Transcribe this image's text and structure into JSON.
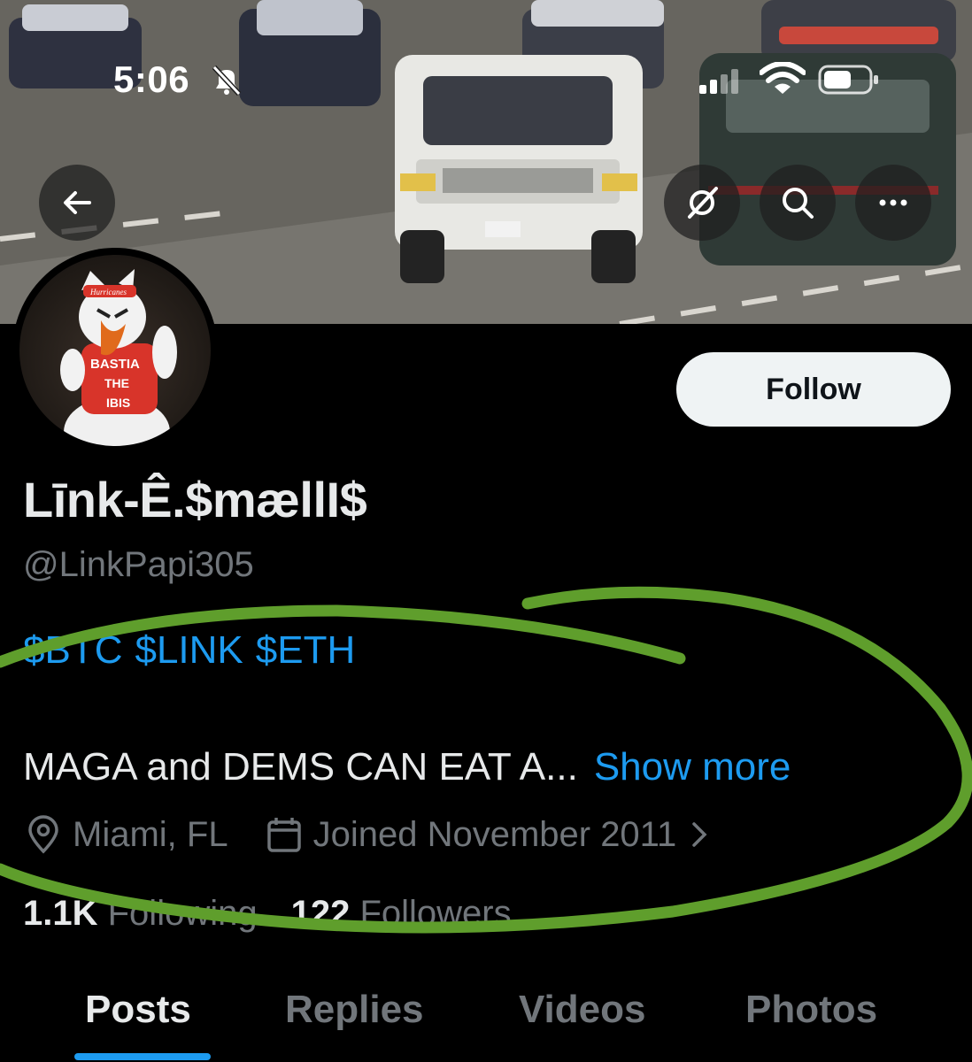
{
  "status_bar": {
    "time": "5:06"
  },
  "header": {
    "back_icon": "arrow-left-icon",
    "grok_icon": "grok-icon",
    "search_icon": "search-icon",
    "more_icon": "more-horizontal-icon"
  },
  "profile": {
    "follow_label": "Follow",
    "display_name": "Līnk-Ê.$mællI$",
    "handle": "@LinkPapi305",
    "bio_tags": [
      "$BTC",
      "$LINK",
      "$ETH"
    ],
    "bio_text": "MAGA and DEMS CAN EAT A...",
    "show_more": "Show more",
    "location": "Miami, FL",
    "joined": "Joined November 2011",
    "following_count": "1.1K",
    "following_label": "Following",
    "followers_count": "122",
    "followers_label": "Followers",
    "avatar_shirt_text": [
      "BASTIA",
      "THE",
      "IBIS"
    ],
    "avatar_cap_text": "Hurricanes"
  },
  "tabs": [
    {
      "label": "Posts",
      "active": true
    },
    {
      "label": "Replies",
      "active": false
    },
    {
      "label": "Videos",
      "active": false
    },
    {
      "label": "Photos",
      "active": false
    }
  ],
  "colors": {
    "accent": "#1d9bf0",
    "annotation": "#5f9e2c",
    "muted": "#71767b"
  }
}
